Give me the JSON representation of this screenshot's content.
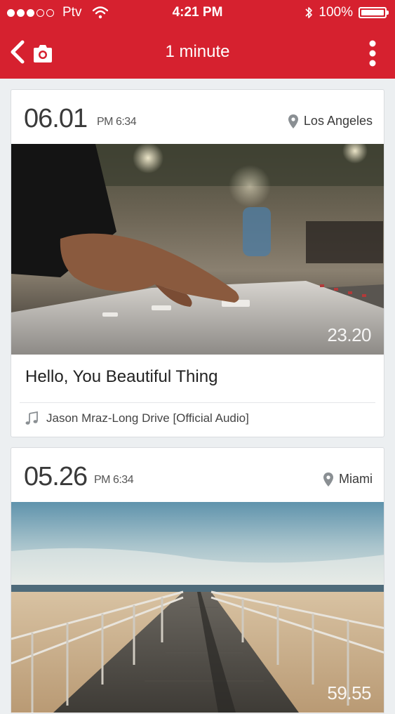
{
  "status": {
    "carrier": "Ptv",
    "time": "4:21 PM",
    "battery": "100%"
  },
  "nav": {
    "title": "1 minute"
  },
  "cards": [
    {
      "date": "06.01",
      "time": "PM 6:34",
      "location": "Los Angeles",
      "duration": "23.20",
      "caption": "Hello, You Beautiful Thing",
      "song": "Jason Mraz-Long Drive [Official Audio]"
    },
    {
      "date": "05.26",
      "time": "PM 6:34",
      "location": "Miami",
      "duration": "59.55"
    }
  ],
  "colors": {
    "brand": "#d6212f",
    "background": "#eceff1"
  },
  "icons": [
    "back-icon",
    "camera-icon",
    "more-vertical-icon",
    "location-pin-icon",
    "music-note-icon",
    "wifi-icon",
    "bluetooth-icon",
    "battery-icon"
  ]
}
